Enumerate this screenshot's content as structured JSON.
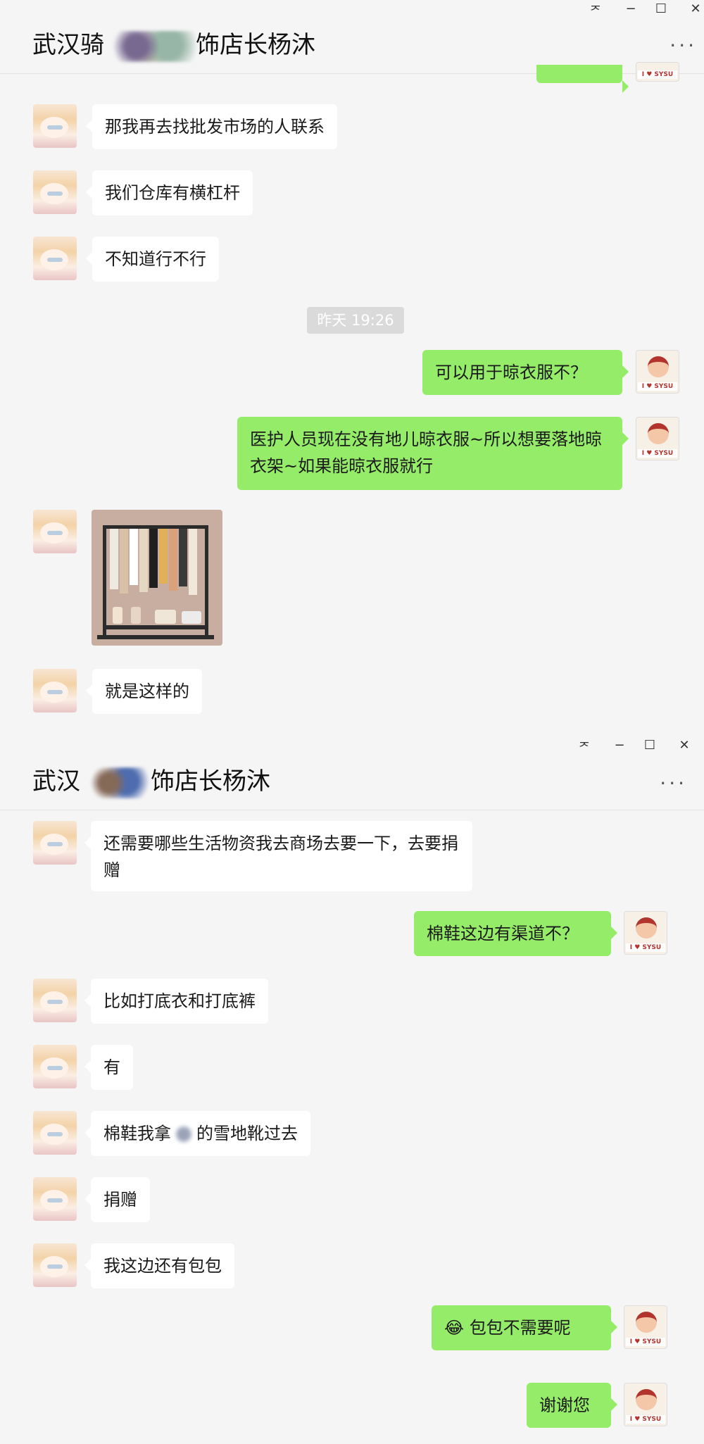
{
  "window_controls": {
    "pin": "ᅎ",
    "minimize": "−",
    "maximize": "☐",
    "close": "✕"
  },
  "panel1": {
    "title_prefix": "武汉骑",
    "title_suffix": "饰店长杨沐",
    "menu": "···",
    "messages": [
      {
        "side": "left",
        "text": "那我再去找批发市场的人联系"
      },
      {
        "side": "left",
        "text": "我们仓库有横杠杆"
      },
      {
        "side": "left",
        "text": "不知道行不行"
      },
      {
        "side": "right",
        "text": "可以用于晾衣服不？"
      },
      {
        "side": "right",
        "text": "医护人员现在没有地儿晾衣服~所以想要落地晾衣架~如果能晾衣服就行"
      },
      {
        "side": "left",
        "text": "就是这样的"
      }
    ],
    "timestamp": "昨天 19:26"
  },
  "panel2": {
    "title_prefix": "武汉",
    "title_suffix": "饰店长杨沐",
    "menu": "···",
    "messages": [
      {
        "side": "left",
        "text": "还需要哪些生活物资我去商场去要一下，去要捐赠"
      },
      {
        "side": "right",
        "text": "棉鞋这边有渠道不？"
      },
      {
        "side": "left",
        "text": "比如打底衣和打底裤"
      },
      {
        "side": "left",
        "text": "有"
      },
      {
        "side": "left",
        "text_before": "棉鞋我拿",
        "text_after": "的雪地靴过去"
      },
      {
        "side": "left",
        "text": "捐赠"
      },
      {
        "side": "left",
        "text": "我这边还有包包"
      },
      {
        "side": "right",
        "emoji": "😂",
        "text": "包包不需要呢"
      },
      {
        "side": "right",
        "text": "谢谢您"
      }
    ]
  },
  "avatar_tag": "I ♥ SYSU",
  "colors": {
    "bubble_right": "#95ec69",
    "bubble_left": "#ffffff",
    "background": "#f5f5f5"
  }
}
